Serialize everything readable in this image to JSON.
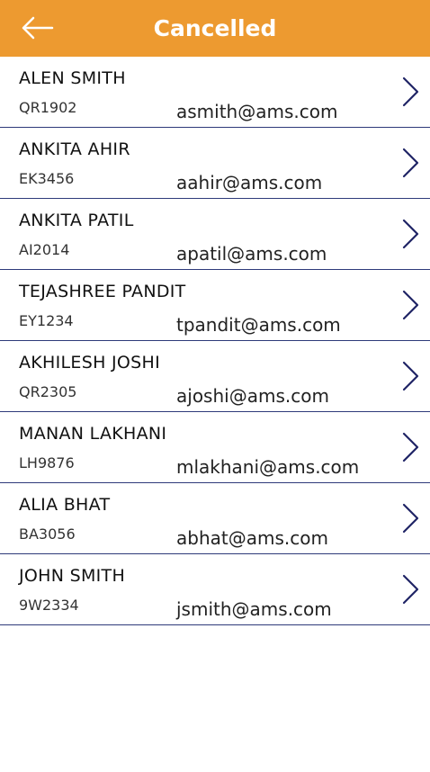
{
  "header": {
    "title": "Cancelled",
    "back_icon": "arrow-left-icon",
    "color": "#ED9A30"
  },
  "rows": [
    {
      "name": "ALEN SMITH",
      "code": "QR1902",
      "email": "asmith@ams.com"
    },
    {
      "name": "ANKITA AHIR",
      "code": "EK3456",
      "email": "aahir@ams.com"
    },
    {
      "name": "ANKITA PATIL",
      "code": "AI2014",
      "email": "apatil@ams.com"
    },
    {
      "name": "TEJASHREE PANDIT",
      "code": "EY1234",
      "email": "tpandit@ams.com"
    },
    {
      "name": "AKHILESH JOSHI",
      "code": "QR2305",
      "email": "ajoshi@ams.com"
    },
    {
      "name": "MANAN LAKHANI",
      "code": "LH9876",
      "email": "mlakhani@ams.com"
    },
    {
      "name": "ALIA BHAT",
      "code": "BA3056",
      "email": "abhat@ams.com"
    },
    {
      "name": "JOHN SMITH",
      "code": "9W2334",
      "email": "jsmith@ams.com"
    }
  ],
  "row_icon": "chevron-right-icon",
  "divider_color": "#2E3A7A",
  "chevron_color": "#1F2466"
}
